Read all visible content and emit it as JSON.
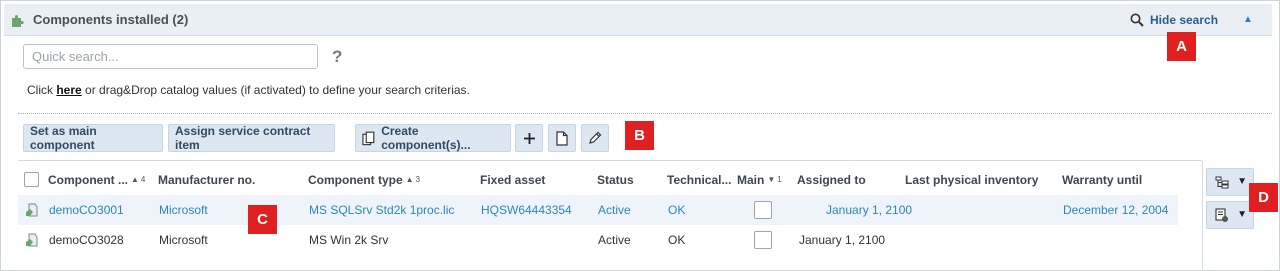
{
  "header": {
    "title": "Components installed (2)",
    "hide_search": "Hide search",
    "puzzle_icon": "puzzle-icon",
    "collapse_icon": "chevron-up-icon"
  },
  "search": {
    "placeholder": "Quick search...",
    "help": "?"
  },
  "hint": {
    "before": "Click ",
    "link": "here",
    "after": " or drag&Drop catalog values (if activated) to define your search criterias."
  },
  "toolbar": {
    "set_main": "Set as main component",
    "assign_contract": "Assign service contract item",
    "create_components": "Create component(s)..."
  },
  "columns": [
    {
      "label": "Component ...",
      "sort": "▲",
      "num": "4"
    },
    {
      "label": "Manufacturer no."
    },
    {
      "label": "Component type",
      "sort": "▲",
      "num": "3"
    },
    {
      "label": "Fixed asset"
    },
    {
      "label": "Status"
    },
    {
      "label": "Technical..."
    },
    {
      "label": "Main",
      "sort": "▼",
      "num": "1"
    },
    {
      "label": "Assigned to"
    },
    {
      "label": "Last physical inventory"
    },
    {
      "label": "Warranty until"
    }
  ],
  "rows": [
    {
      "component": "demoCO3001",
      "manufacturer_no": "Microsoft",
      "component_type": "MS SQLSrv Std2k 1proc.lic",
      "fixed_asset": "HQSW64443354",
      "status": "Active",
      "technical": "OK",
      "main": false,
      "assigned_to": "January 1, 2100",
      "last_inventory": "",
      "warranty_until": "December 12, 2004"
    },
    {
      "component": "demoCO3028",
      "manufacturer_no": "Microsoft",
      "component_type": "MS Win 2k Srv",
      "fixed_asset": "",
      "status": "Active",
      "technical": "OK",
      "main": false,
      "assigned_to": "January 1, 2100",
      "last_inventory": "",
      "warranty_until": ""
    }
  ],
  "markers": {
    "a": "A",
    "b": "B",
    "c": "C",
    "d": "D"
  },
  "colors": {
    "link": "#2e86b8",
    "header_bg": "#e9eff5",
    "button_bg": "#dde7f1",
    "marker": "#e02020"
  }
}
